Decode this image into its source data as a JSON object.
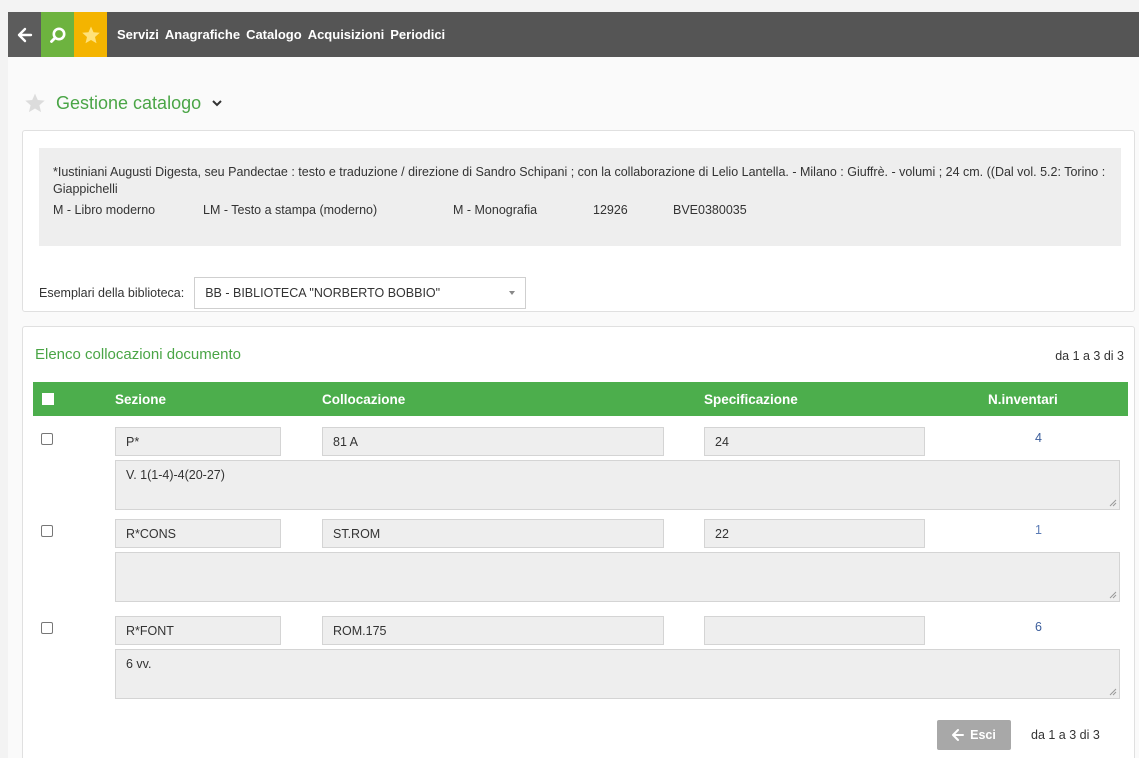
{
  "nav": {
    "menu": [
      "Servizi",
      "Anagrafiche",
      "Catalogo",
      "Acquisizioni",
      "Periodici"
    ]
  },
  "title": "Gestione catalogo",
  "record": {
    "description": "*Iustiniani Augusti Digesta, seu Pandectae : testo e traduzione / direzione di Sandro Schipani ; con la collaborazione di Lelio Lantella. - Milano : Giuffrè. - volumi ; 24 cm. ((Dal vol. 5.2: Torino : Giappichelli",
    "natura": "M - Libro moderno",
    "tipo": "LM - Testo a stampa (moderno)",
    "livello": "M - Monografia",
    "id": "12926",
    "bid": "BVE0380035"
  },
  "esemplari": {
    "label": "Esemplari della biblioteca:",
    "selected": "BB - BIBLIOTECA \"NORBERTO BOBBIO\""
  },
  "list": {
    "title": "Elenco collocazioni documento",
    "range": "da 1 a 3 di 3",
    "headers": {
      "sezione": "Sezione",
      "collocazione": "Collocazione",
      "specificazione": "Specificazione",
      "ninventari": "N.inventari"
    },
    "rows": [
      {
        "sezione": "P*",
        "collocazione": "81 A",
        "specificazione": "24",
        "ninventari": "4",
        "note": "V. 1(1-4)-4(20-27)"
      },
      {
        "sezione": "R*CONS",
        "collocazione": "ST.ROM",
        "specificazione": "22",
        "ninventari": "1",
        "note": ""
      },
      {
        "sezione": "R*FONT",
        "collocazione": "ROM.175",
        "specificazione": "",
        "ninventari": "6",
        "note": "6 vv."
      }
    ]
  },
  "footer": {
    "esci_label": "Esci",
    "range": "da 1 a 3 di 3"
  },
  "colors": {
    "accent_green": "#4aa546",
    "header_green": "#4cae4c",
    "topbar": "#555555",
    "search_btn": "#6db33f",
    "star_btn": "#f4b400",
    "link_blue": "#3c5e9c"
  }
}
